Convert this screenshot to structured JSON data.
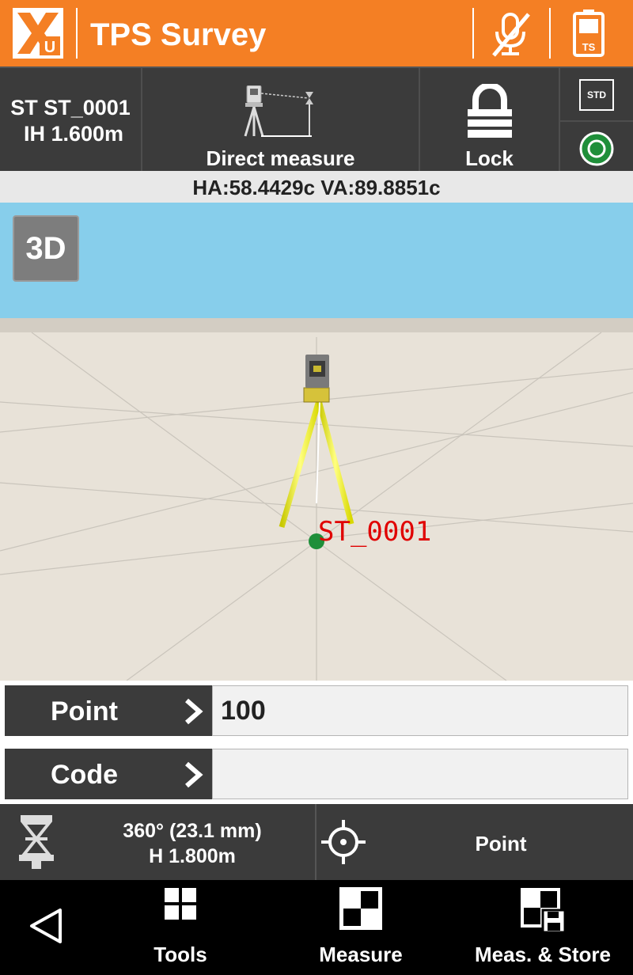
{
  "header": {
    "title": "TPS Survey",
    "logo_letter": "U",
    "battery_label": "TS",
    "accent_color": "#f47f24"
  },
  "station": {
    "name": "ST ST_0001",
    "instrument_height": "IH 1.600m",
    "mode_label": "Direct measure",
    "lock_label": "Lock",
    "std_label": "STD"
  },
  "angles": "HA:58.4429c  VA:89.8851c",
  "view": {
    "toggle_label": "3D",
    "station_label": "ST_0001",
    "station_label_color": "#e00000",
    "sky_color": "#87ceeb",
    "ground_color": "#e8e2d8"
  },
  "fields": {
    "point_label": "Point",
    "point_value": "100",
    "code_label": "Code",
    "code_value": ""
  },
  "target": {
    "prism_info": "360° (23.1 mm)",
    "target_height": "H 1.800m",
    "mode": "Point"
  },
  "nav": {
    "tools": "Tools",
    "measure": "Measure",
    "meas_store": "Meas. & Store"
  }
}
